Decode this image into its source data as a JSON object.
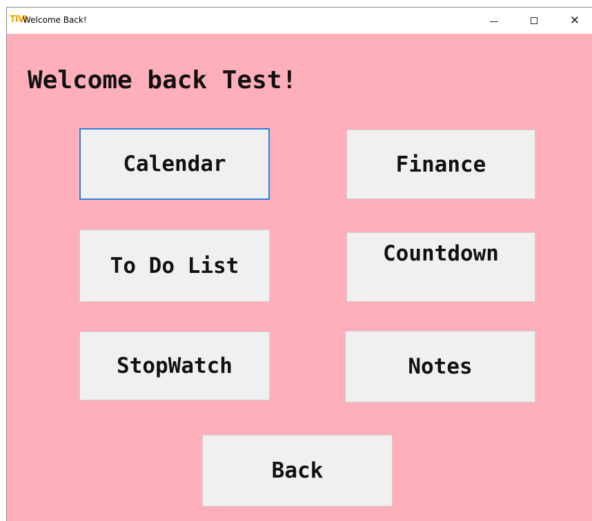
{
  "window": {
    "title": "Welcome Back!",
    "icon": "app-icon",
    "controls": {
      "minimize": "minimize-icon",
      "maximize": "maximize-icon",
      "close": "close-icon",
      "close_glyph": "✕"
    }
  },
  "main": {
    "greeting": "Welcome back Test!",
    "buttons": {
      "calendar": "Calendar",
      "finance": "Finance",
      "todo": "To Do List",
      "countdown": "Countdown",
      "stopwatch": "StopWatch",
      "notes": "Notes",
      "back": "Back"
    },
    "focused_button": "Calendar"
  },
  "colors": {
    "background": "#ffafb9",
    "button_face": "#f0f0f0",
    "focus_border": "#2f7fd6",
    "text": "#111111"
  }
}
